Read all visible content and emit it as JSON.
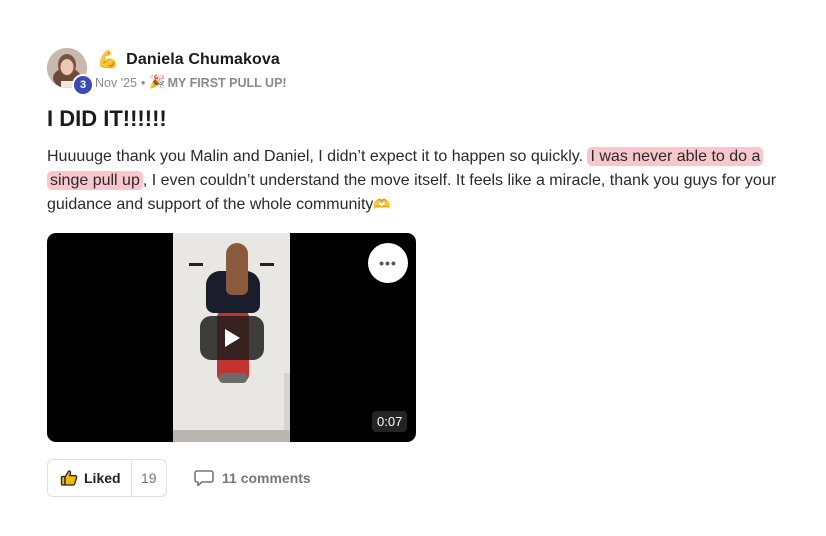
{
  "author": {
    "name": "Daniela Chumakova",
    "level": "3",
    "status_emoji": "💪"
  },
  "meta": {
    "date": "Nov '25",
    "separator": "•",
    "category_emoji": "🎉",
    "category": "MY FIRST PULL UP!"
  },
  "post": {
    "title": "I DID IT!!!!!!",
    "text_before": "Huuuuge thank you Malin and Daniel, I didn’t expect it to happen so quickly. ",
    "text_highlight": "I was never able to do a singe pull up",
    "text_after": ", I even couldn’t understand the move itself. It feels like a miracle, thank you guys for your guidance and support of the whole community",
    "text_emoji": "🫶"
  },
  "video": {
    "duration": "0:07",
    "more_label": "•••"
  },
  "actions": {
    "like_label": "Liked",
    "like_count": "19",
    "comments_label": "11 comments"
  },
  "colors": {
    "highlight": "#f7c7cd",
    "level_badge": "#3b4bb5"
  }
}
